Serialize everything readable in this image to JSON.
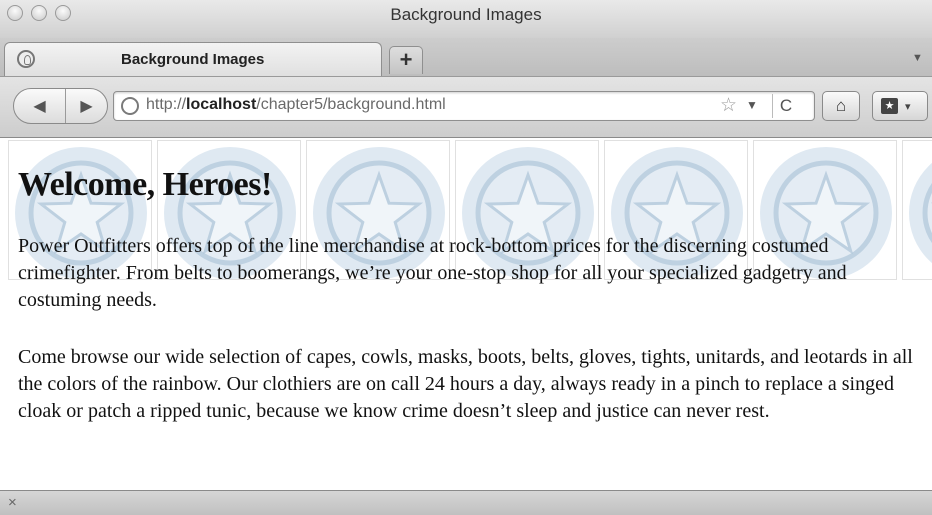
{
  "window": {
    "title": "Background Images"
  },
  "tabs": [
    {
      "label": "Background Images",
      "active": true
    }
  ],
  "toolbar": {
    "new_tab_label": "+",
    "url_prefix": "http://",
    "url_host": "localhost",
    "url_path": "/chapter5/background.html",
    "back_label": "◀",
    "forward_label": "▶",
    "star_label": "☆",
    "dropdown_label": "▼",
    "reload_label": "C",
    "home_label": "🏠",
    "bookmarks_label": "★",
    "bookmarks_arrow": "▾"
  },
  "page": {
    "heading": "Welcome, Heroes!",
    "paragraphs": [
      "Power Outfitters offers top of the line merchandise at rock-bottom prices for the discerning costumed crimefighter. From belts to boomerangs, we’re your one-stop shop for all your specialized gadgetry and costuming needs.",
      "Come browse our wide selection of capes, cowls, masks, boots, belts, gloves, tights, unitards, and leotards in all the colors of the rainbow. Our clothiers are on call 24 hours a day, always ready in a pinch to replace a singed cloak or patch a ripped tunic, because we know crime doesn’t sleep and justice can never rest."
    ],
    "background_icon": "star-shield-icon",
    "background_tile_count": 7
  },
  "statusbar": {
    "close_label": "×"
  },
  "colors": {
    "tile_circle": "#c9dbe9",
    "tile_ring": "#b4cadc",
    "tile_star_fill": "#e6eef5"
  }
}
